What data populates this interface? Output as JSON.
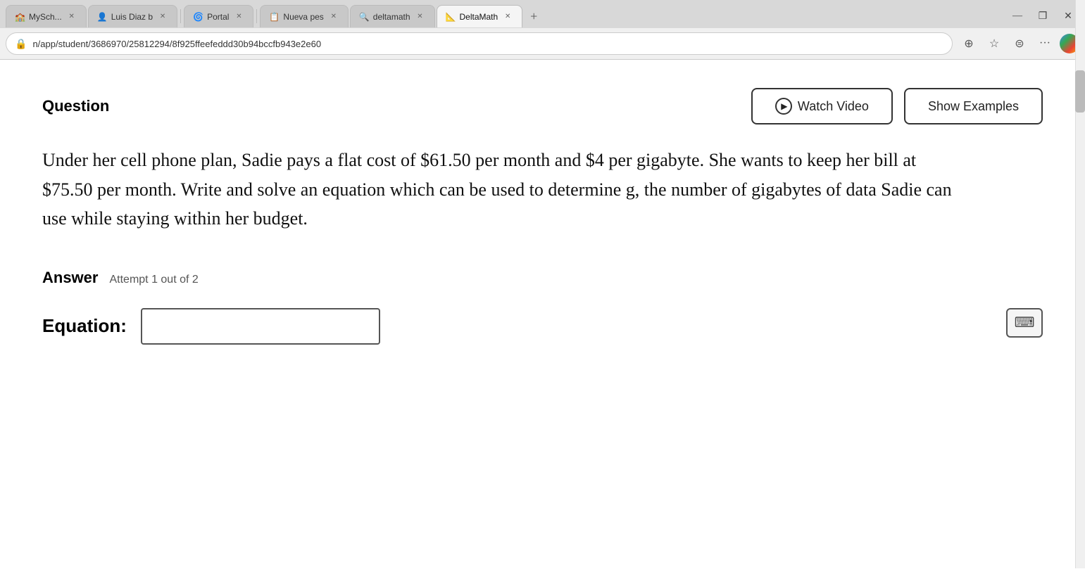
{
  "browser": {
    "tabs": [
      {
        "id": "tab1",
        "label": "MySch...",
        "favicon": "🏫",
        "active": false,
        "closeable": true
      },
      {
        "id": "tab2",
        "label": "Luis Diaz b",
        "favicon": "👤",
        "active": false,
        "closeable": true
      },
      {
        "id": "tab3",
        "label": "Portal",
        "favicon": "🌀",
        "active": false,
        "closeable": true
      },
      {
        "id": "tab4",
        "label": "Nueva pes",
        "favicon": "📋",
        "active": false,
        "closeable": true
      },
      {
        "id": "tab5",
        "label": "deltamath",
        "favicon": "🔍",
        "active": false,
        "closeable": true
      },
      {
        "id": "tab6",
        "label": "DeltaMath",
        "favicon": "📐",
        "active": true,
        "closeable": true
      }
    ],
    "url": "n/app/student/3686970/25812294/8f925ffeefeddd30b94bccfb943e2e60",
    "window_controls": {
      "minimize": "—",
      "restore": "❐",
      "close": "✕"
    }
  },
  "page": {
    "question_label": "Question",
    "watch_video_label": "Watch Video",
    "show_examples_label": "Show Examples",
    "question_text": "Under her cell phone plan, Sadie pays a flat cost of $61.50 per month and $4 per gigabyte. She wants to keep her bill at $75.50 per month. Write and solve an equation which can be used to determine g, the number of gigabytes of data Sadie can use while staying within her budget.",
    "answer_label": "Answer",
    "attempt_text": "Attempt 1 out of 2",
    "equation_label": "Equation:",
    "equation_placeholder": "",
    "keyboard_icon": "⌨"
  }
}
